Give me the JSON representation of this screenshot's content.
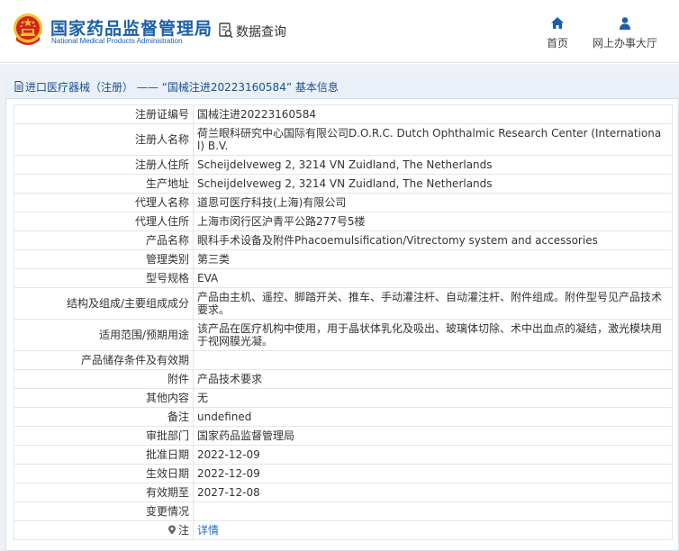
{
  "header": {
    "org_name_cn": "国家药品监督管理局",
    "org_name_en": "National Medical Products Administration",
    "query_label": "数据查询",
    "nav": [
      {
        "label": "首页",
        "icon": "home-icon"
      },
      {
        "label": "网上办事大厅",
        "icon": "user-icon"
      }
    ]
  },
  "breadcrumb": {
    "text": "进口医疗器械（注册） —— “国械注进20223160584” 基本信息",
    "icon": "document-icon"
  },
  "colors": {
    "brand_blue": "#1b5fa8",
    "link_blue": "#1b6fc9",
    "emblem_red": "#d4241b",
    "emblem_gold": "#f3c22c"
  },
  "rows": [
    {
      "label": "注册证编号",
      "value": "国械注进20223160584"
    },
    {
      "label": "注册人名称",
      "value": "荷兰眼科研究中心国际有限公司D.O.R.C. Dutch Ophthalmic Research Center (International) B.V."
    },
    {
      "label": "注册人住所",
      "value": "Scheijdelveweg 2, 3214 VN Zuidland, The Netherlands"
    },
    {
      "label": "生产地址",
      "value": "Scheijdelveweg 2, 3214 VN Zuidland, The Netherlands"
    },
    {
      "label": "代理人名称",
      "value": "道恩可医疗科技(上海)有限公司"
    },
    {
      "label": "代理人住所",
      "value": "上海市闵行区沪青平公路277号5楼"
    },
    {
      "label": "产品名称",
      "value": "眼科手术设备及附件Phacoemulsification/Vitrectomy system and accessories"
    },
    {
      "label": "管理类别",
      "value": "第三类"
    },
    {
      "label": "型号规格",
      "value": "EVA"
    },
    {
      "label": "结构及组成/主要组成成分",
      "value": "产品由主机、遥控、脚踏开关、推车、手动灌注杆、自动灌注杆、附件组成。附件型号见产品技术要求。"
    },
    {
      "label": "适用范围/预期用途",
      "value": "该产品在医疗机构中使用，用于晶状体乳化及吸出、玻璃体切除、术中出血点的凝结，激光模块用于视网膜光凝。"
    },
    {
      "label": "产品储存条件及有效期",
      "value": ""
    },
    {
      "label": "附件",
      "value": "产品技术要求"
    },
    {
      "label": "其他内容",
      "value": "无"
    },
    {
      "label": "备注",
      "value": "undefined"
    },
    {
      "label": "审批部门",
      "value": "国家药品监督管理局"
    },
    {
      "label": "批准日期",
      "value": "2022-12-09"
    },
    {
      "label": "生效日期",
      "value": "2022-12-09"
    },
    {
      "label": "有效期至",
      "value": "2027-12-08"
    },
    {
      "label": "变更情况",
      "value": ""
    },
    {
      "label": "注",
      "value": "详情"
    }
  ]
}
